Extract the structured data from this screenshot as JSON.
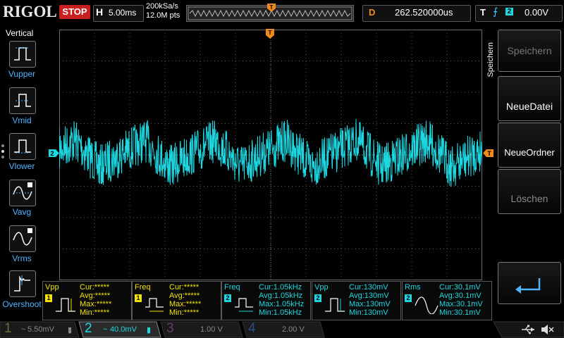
{
  "header": {
    "logo": "RIGOL",
    "run_state": "STOP",
    "timebase_label": "H",
    "timebase_value": "5.00ms",
    "sample_rate": "200kSa/s",
    "memory_depth": "12.0M pts",
    "delay_label": "D",
    "delay_value": "262.520000us",
    "trigger_label": "T",
    "trigger_source": "2",
    "trigger_level": "0.00V",
    "trigger_marker": "T"
  },
  "left_menu": {
    "title": "Vertical",
    "items": [
      {
        "label": "Vupper",
        "icon": "vupper-icon"
      },
      {
        "label": "Vmid",
        "icon": "vmid-icon"
      },
      {
        "label": "Vlower",
        "icon": "vlower-icon"
      },
      {
        "label": "Vavg",
        "icon": "vavg-icon"
      },
      {
        "label": "Vrms",
        "icon": "vrms-icon"
      },
      {
        "label": "Overshoot",
        "icon": "overshoot-icon"
      }
    ]
  },
  "right_menu": {
    "title": "Speichern",
    "items": [
      {
        "label": "Speichern",
        "enabled": false
      },
      {
        "label": "NeueDatei",
        "enabled": true
      },
      {
        "label": "NeueOrdner",
        "enabled": true
      },
      {
        "label": "Löschen",
        "enabled": false
      }
    ],
    "enter_icon": "enter-arrow-icon"
  },
  "waveform": {
    "channel_marker": "2",
    "color": "#1ed6e0",
    "trigger_level_marker": "T"
  },
  "measurements": [
    {
      "name": "Vpp",
      "channel": "1",
      "cur": "Cur:*****",
      "avg": "Avg:*****",
      "max": "Max:*****",
      "min": "Min:*****",
      "icon": "pulse-icon"
    },
    {
      "name": "Freq",
      "channel": "1",
      "cur": "Cur:*****",
      "avg": "Avg:*****",
      "max": "Max:*****",
      "min": "Min:*****",
      "icon": "period-icon"
    },
    {
      "name": "Freq",
      "channel": "2",
      "cur": "Cur:1.05kHz",
      "avg": "Avg:1.05kHz",
      "max": "Max:1.05kHz",
      "min": "Min:1.05kHz",
      "icon": "period-icon"
    },
    {
      "name": "Vpp",
      "channel": "2",
      "cur": "Cur:130mV",
      "avg": "Avg:130mV",
      "max": "Max:130mV",
      "min": "Min:130mV",
      "icon": "pulse-icon"
    },
    {
      "name": "Rms",
      "channel": "2",
      "cur": "Cur:30.1mV",
      "avg": "Avg:30.1mV",
      "max": "Max:30.1mV",
      "min": "Min:30.1mV",
      "icon": "sine-icon"
    }
  ],
  "channels": [
    {
      "num": "1",
      "value": "5.50mV",
      "coupling": "~",
      "color": "#f2e300",
      "active": false
    },
    {
      "num": "2",
      "value": "40.0mV",
      "coupling": "~",
      "color": "#1ed6e0",
      "active": true
    },
    {
      "num": "3",
      "value": "1.00 V",
      "coupling": "",
      "color": "#e040d0",
      "active": false
    },
    {
      "num": "4",
      "value": "2.00 V",
      "coupling": "",
      "color": "#2f7dff",
      "active": false
    }
  ],
  "status_icons": [
    "usb-icon",
    "speaker-muted-icon"
  ],
  "colors": {
    "ch1": "#f2e300",
    "ch2": "#1ed6e0",
    "trigger": "#f08a1c",
    "stop": "#c8201e"
  }
}
